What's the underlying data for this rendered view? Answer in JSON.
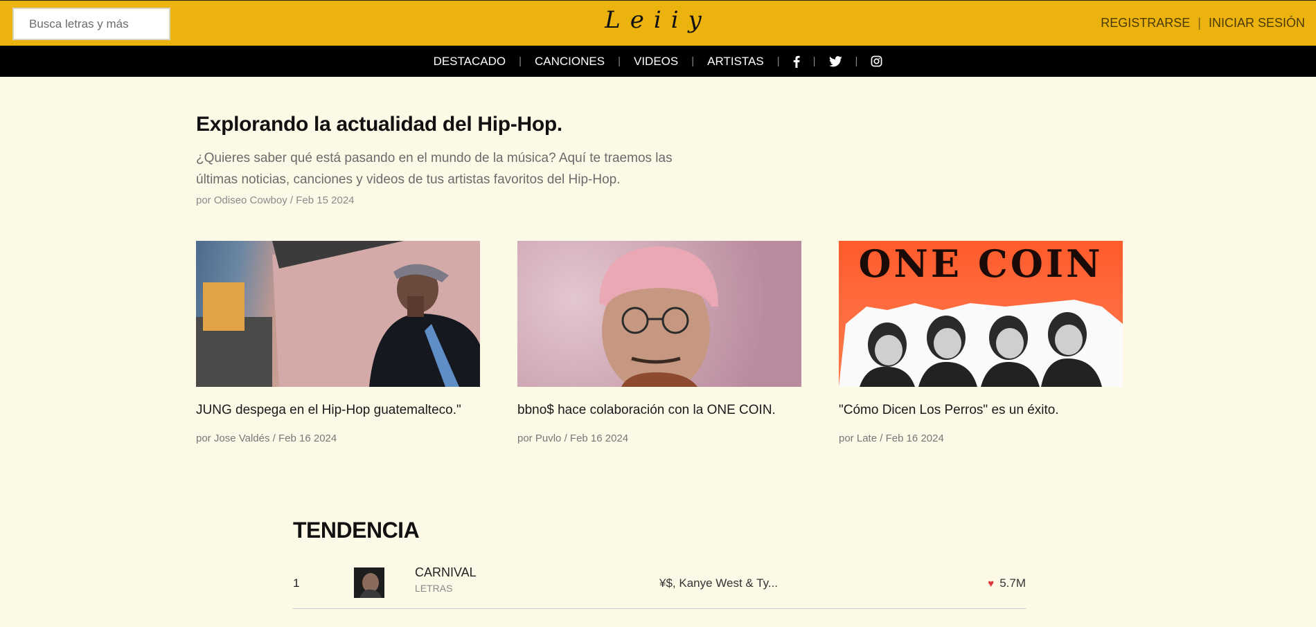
{
  "header": {
    "search_placeholder": "Busca letras y más",
    "logo": "Leiiy",
    "register": "REGISTRARSE",
    "login": "INICIAR SESIÓN",
    "auth_separator": "|",
    "accent_color": "#ecb30f"
  },
  "nav": {
    "items": [
      "DESTACADO",
      "CANCIONES",
      "VIDEOS",
      "ARTISTAS"
    ],
    "separator": "|",
    "social_icons": [
      "facebook-icon",
      "twitter-icon",
      "instagram-icon"
    ]
  },
  "hero": {
    "title": "Explorando la actualidad del Hip-Hop.",
    "description": "¿Quieres saber qué está pasando en el mundo de la música? Aquí te traemos las últimas noticias, canciones y videos de tus artistas favoritos del Hip-Hop.",
    "by_prefix": "por",
    "author": "Odiseo Cowboy",
    "date_sep": "/",
    "date": "Feb 15 2024"
  },
  "articles": [
    {
      "title": "JUNG despega en el Hip-Hop guatemalteco.\"",
      "author": "Jose Valdés",
      "date": "Feb 16 2024",
      "by_prefix": "por",
      "date_sep": "/"
    },
    {
      "title": "bbno$ hace colaboración con la ONE COIN.",
      "author": "Puvlo",
      "date": "Feb 16 2024",
      "by_prefix": "por",
      "date_sep": "/"
    },
    {
      "title": "\"Cómo Dicen Los Perros\" es un éxito.",
      "author": "Late",
      "date": "Feb 16 2024",
      "by_prefix": "por",
      "date_sep": "/"
    }
  ],
  "article3_image_text": "ONE COIN",
  "trending": {
    "heading": "TENDENCIA",
    "rows": [
      {
        "rank": "1",
        "song": "CARNIVAL",
        "type": "LETRAS",
        "artist": "¥$, Kanye West & Ty...",
        "likes": "5.7M"
      }
    ]
  }
}
